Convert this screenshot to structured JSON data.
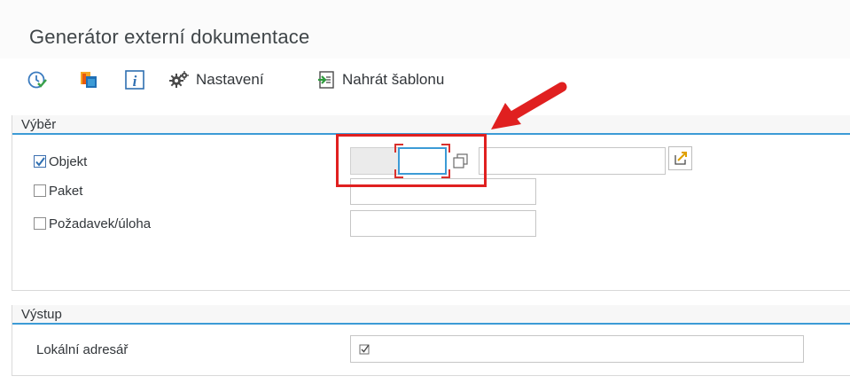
{
  "window": {
    "title": "Generátor externí dokumentace"
  },
  "toolbar": {
    "execute_icon": "execute-clock-icon",
    "copy_icon": "copy-objects-icon",
    "info_icon": "info-icon",
    "settings_icon": "gear-icon",
    "settings_label": "Nastavení",
    "upload_icon": "upload-template-icon",
    "upload_label": "Nahrát šablonu"
  },
  "selection": {
    "title": "Výběr",
    "object": {
      "label": "Objekt",
      "checked": true
    },
    "package": {
      "label": "Paket",
      "checked": false
    },
    "request": {
      "label": "Požadavek/úloha",
      "checked": false
    }
  },
  "output": {
    "title": "Výstup",
    "local_dir": {
      "label": "Lokální adresář"
    }
  },
  "colors": {
    "accent": "#3c9bd6",
    "highlight_red": "#e02020"
  }
}
